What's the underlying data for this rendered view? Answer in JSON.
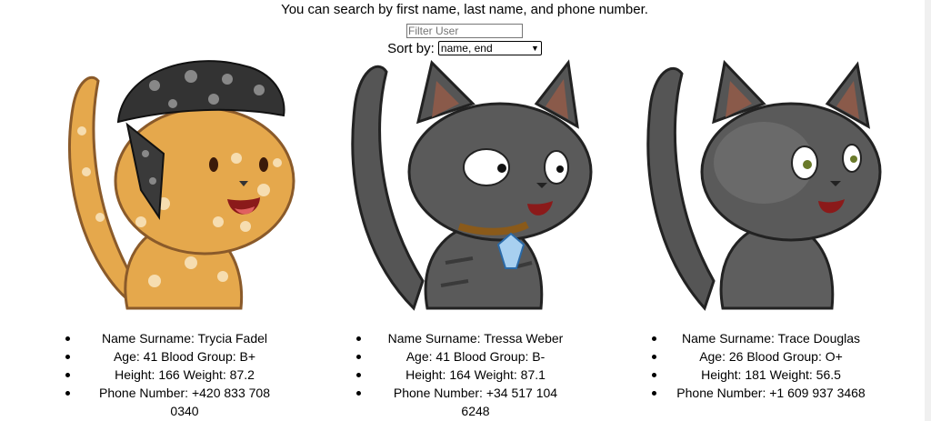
{
  "header": {
    "instructions": "You can search by first name, last name, and phone number.",
    "filter_placeholder": "Filter User",
    "filter_value": "",
    "sort_label": "Sort by:",
    "sort_selected": "name, end"
  },
  "users": [
    {
      "avatar": "spotted-orange-cat-with-bandana",
      "name_line": "Name Surname: Trycia Fadel",
      "age_line": "Age: 41 Blood Group: B+",
      "size_line": "Height: 166 Weight: 87.2",
      "phone_line": "Phone Number: +420 833 708 0340"
    },
    {
      "avatar": "gray-striped-cat-with-gem-collar",
      "name_line": "Name Surname: Tressa Weber",
      "age_line": "Age: 41 Blood Group: B-",
      "size_line": "Height: 164 Weight: 87.1",
      "phone_line": "Phone Number: +34 517 104 6248"
    },
    {
      "avatar": "dark-gray-cat",
      "name_line": "Name Surname: Trace Douglas",
      "age_line": "Age: 26 Blood Group: O+",
      "size_line": "Height: 181 Weight: 56.5",
      "phone_line": "Phone Number: +1 609 937 3468"
    }
  ]
}
